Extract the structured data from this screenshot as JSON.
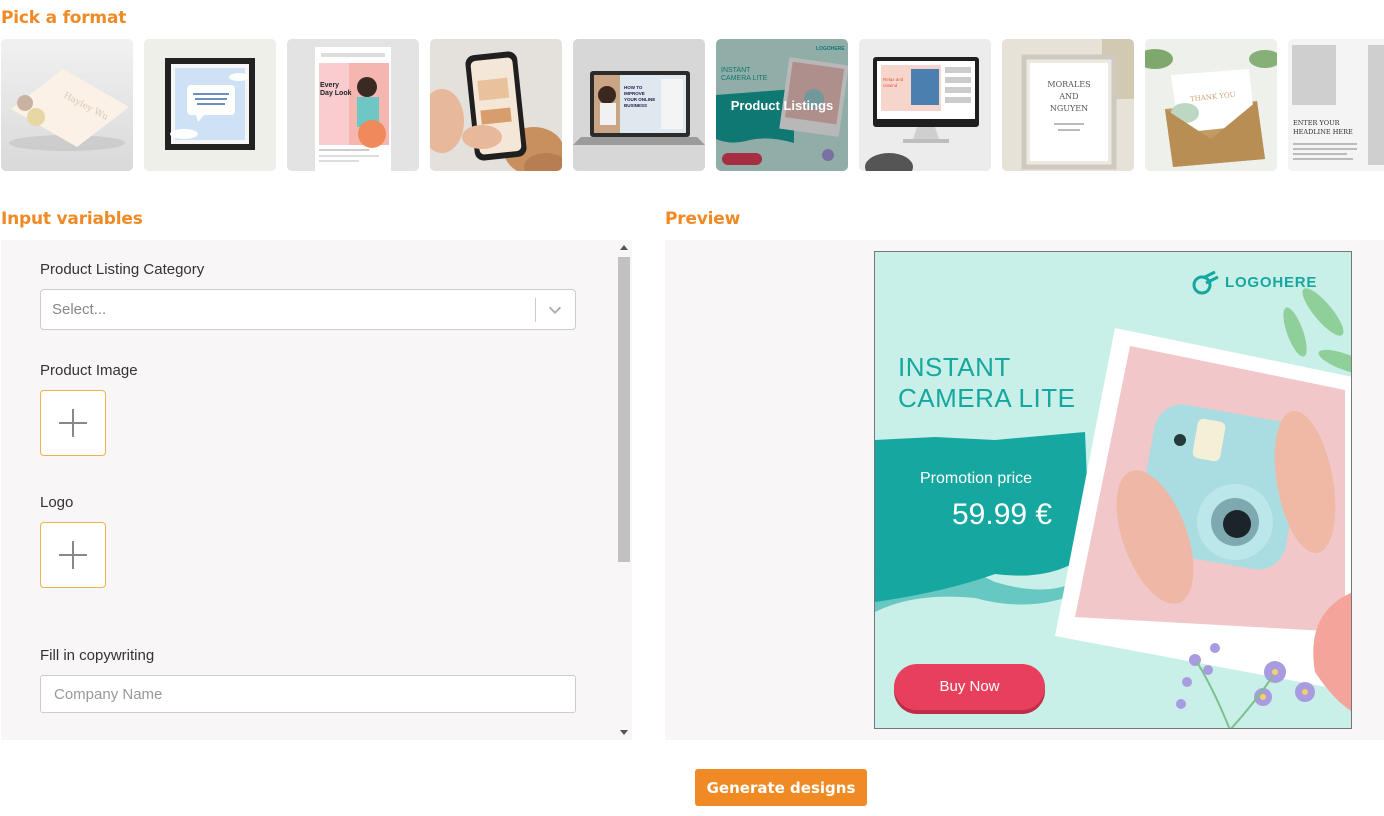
{
  "pick_format": {
    "title": "Pick a format",
    "items": [
      {
        "label": "Business Card",
        "visible_text": "Hayley Wu"
      },
      {
        "label": "Framed Quote",
        "visible_text": ""
      },
      {
        "label": "Instagram Post",
        "visible_text": "Every Day Look"
      },
      {
        "label": "Mobile Story",
        "visible_text": ""
      },
      {
        "label": "Laptop Web Banner",
        "visible_text": "HOW TO IMPROVE YOUR ONLINE BUSINESS"
      },
      {
        "label": "Product Listings",
        "visible_text": "INSTANT CAMERA LITE",
        "selected": true
      },
      {
        "label": "Desktop Ad",
        "visible_text": ""
      },
      {
        "label": "Wedding Invitation",
        "visible_text": "MORALES AND NGUYEN"
      },
      {
        "label": "Thank You Card",
        "visible_text": "THANK YOU"
      },
      {
        "label": "Headline Post",
        "visible_text": "ENTER YOUR HEADLINE HERE"
      }
    ],
    "hover_label": "Product Listings"
  },
  "input_variables": {
    "title": "Input variables",
    "category_label": "Product Listing Category",
    "category_placeholder": "Select...",
    "product_image_label": "Product Image",
    "logo_label": "Logo",
    "copywriting_label": "Fill in copywriting",
    "company_name_placeholder": "Company Name"
  },
  "preview": {
    "title": "Preview",
    "logo_text": "LOGOHERE",
    "headline_line1": "INSTANT",
    "headline_line2": "CAMERA LITE",
    "promo_label": "Promotion price",
    "price": "59.99 €",
    "cta": "Buy Now"
  },
  "actions": {
    "generate_label": "Generate designs"
  },
  "colors": {
    "accent": "#f08a24",
    "panel_bg": "#f8f6f6",
    "teal": "#15a7a0",
    "mint": "#c9f0e8",
    "cta_red": "#e8405c",
    "upload_border": "#e9b54a"
  },
  "icons": {
    "plus": "plus-icon",
    "chevron": "chevron-down-icon",
    "logo": "logo-mark-icon"
  }
}
